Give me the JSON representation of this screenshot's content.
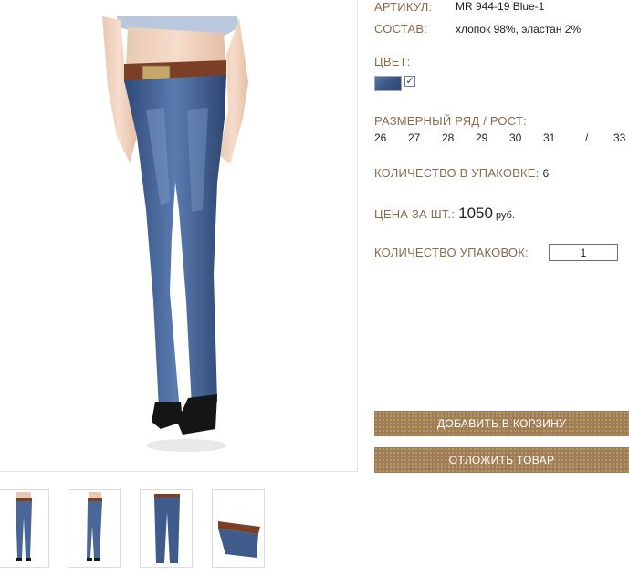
{
  "product": {
    "article_label": "АРТИКУЛ:",
    "article_value": "MR 944-19 Blue-1",
    "composition_label": "СОСТАВ:",
    "composition_value": "хлопок 98%, эластан 2%",
    "color_label": "ЦВЕТ:",
    "color_checkbox_mark": "✓",
    "size_label": "РАЗМЕРНЫЙ РЯД / РОСТ:",
    "sizes": [
      "26",
      "27",
      "28",
      "29",
      "30",
      "31",
      "/",
      "33"
    ],
    "pack_qty_label": "КОЛИЧЕСТВО В УПАКОВКЕ:",
    "pack_qty_value": "6",
    "price_label": "ЦЕНА ЗА ШТ.:",
    "price_value": "1050",
    "price_unit": "руб.",
    "packs_label": "КОЛИЧЕСТВО УПАКОВОК:",
    "packs_value": "1"
  },
  "buttons": {
    "add_to_cart": "ДОБАВИТЬ В КОРЗИНУ",
    "defer": "ОТЛОЖИТЬ ТОВАР"
  },
  "colors": {
    "label_brown": "#8b6a4c",
    "button_brown": "#a17d52",
    "denim": "#3c5684"
  }
}
